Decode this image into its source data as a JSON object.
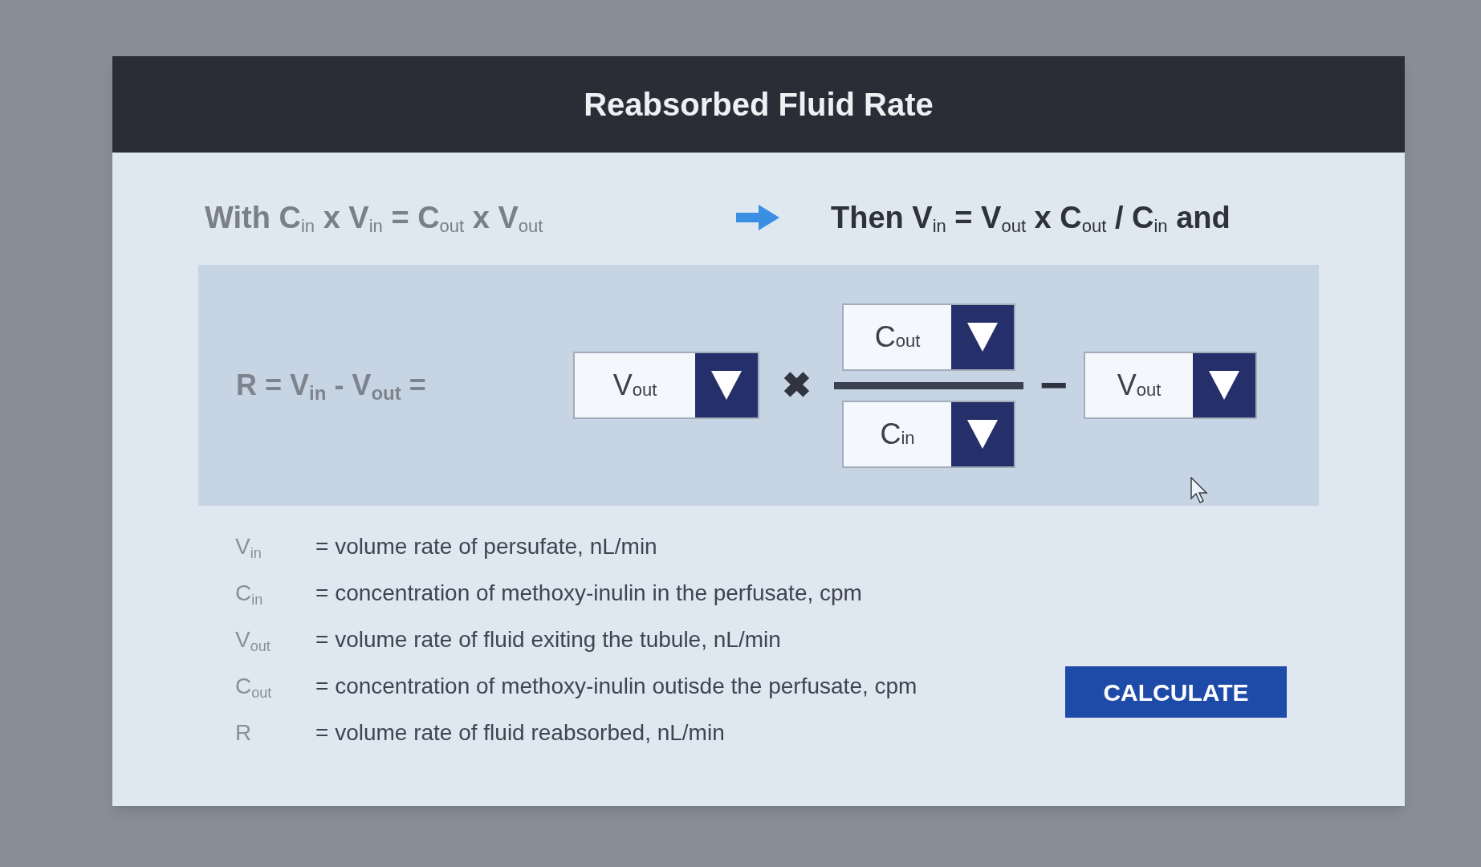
{
  "dialog": {
    "title": "Reabsorbed Fluid Rate"
  },
  "premise": "With C$_{in}$ x V$_{in}$ = C$_{out}$ x V$_{out}$",
  "conclusion": "Then V$_{in}$ = V$_{out}$ x C$_{out}$ / C$_{in}$ and",
  "equation": {
    "lhs": "R = V$_{in}$ - V$_{out}$ =",
    "factor": {
      "value": "V$_{out}$"
    },
    "times": "✖",
    "numerator": {
      "value": "C$_{out}$"
    },
    "denominator": {
      "value": "C$_{in}$"
    },
    "minus": "−",
    "subtrahend": {
      "value": "V$_{out}$"
    }
  },
  "legend": [
    {
      "symbol": "V$_{in}$",
      "description": "= volume rate of persufate, nL/min"
    },
    {
      "symbol": "C$_{in}$",
      "description": "= concentration of methoxy-inulin in the perfusate, cpm"
    },
    {
      "symbol": "V$_{out}$",
      "description": "= volume rate of fluid exiting the tubule, nL/min"
    },
    {
      "symbol": "C$_{out}$",
      "description": "= concentration of methoxy-inulin outisde the perfusate, cpm"
    },
    {
      "symbol": "R",
      "description": "= volume rate of fluid reabsorbed, nL/min"
    }
  ],
  "calculate_button": "CALCULATE"
}
